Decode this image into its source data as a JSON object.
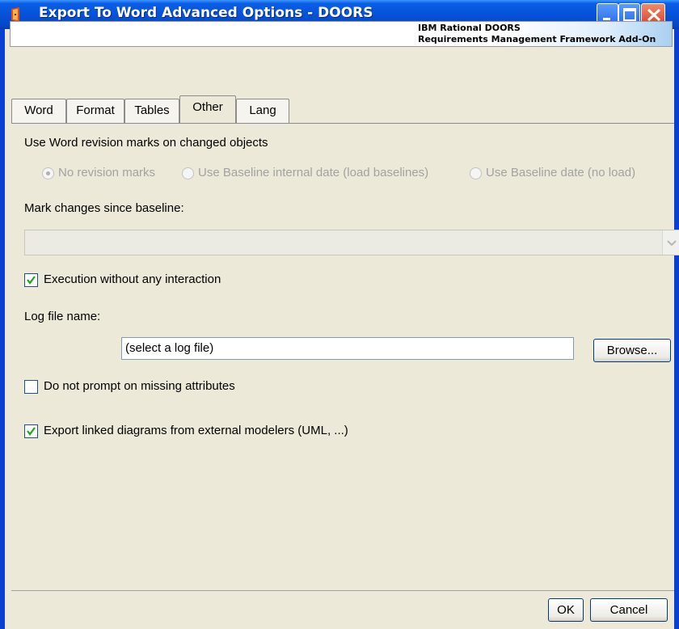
{
  "window": {
    "title": "Export To Word Advanced Options - DOORS"
  },
  "banner": {
    "line1": "IBM Rational DOORS",
    "line2": "Requirements Management Framework Add-On"
  },
  "tabs": [
    {
      "label": "Word",
      "selected": false
    },
    {
      "label": "Format",
      "selected": false
    },
    {
      "label": "Tables",
      "selected": false
    },
    {
      "label": "Other",
      "selected": true
    },
    {
      "label": "Lang",
      "selected": false
    }
  ],
  "revision": {
    "heading": "Use Word revision marks on changed objects",
    "options": [
      {
        "label": "No revision marks",
        "selected": true
      },
      {
        "label": "Use Baseline internal date (load baselines)",
        "selected": false
      },
      {
        "label": "Use Baseline date (no load)",
        "selected": false
      }
    ]
  },
  "baseline": {
    "label": "Mark changes since baseline:",
    "value": ""
  },
  "execution": {
    "label": "Execution without any interaction",
    "checked": true
  },
  "logfile": {
    "label": "Log file name:",
    "value": "(select a log file)",
    "browse_label": "Browse..."
  },
  "missing_attributes": {
    "label": "Do not prompt on missing attributes",
    "checked": false
  },
  "linked_diagrams": {
    "label": "Export linked diagrams from external modelers (UML, ...)",
    "checked": true
  },
  "footer": {
    "ok_label": "OK",
    "cancel_label": "Cancel"
  }
}
